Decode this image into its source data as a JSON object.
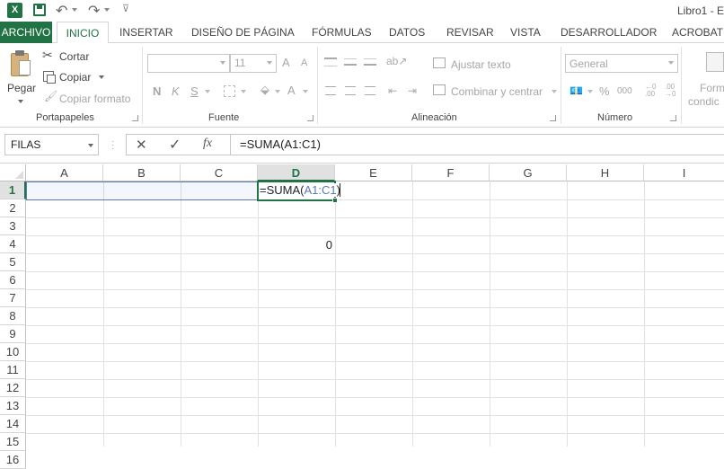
{
  "titlebar": {
    "title": "Libro1 - E"
  },
  "tabs": [
    "ARCHIVO",
    "INICIO",
    "INSERTAR",
    "DISEÑO DE PÁGINA",
    "FÓRMULAS",
    "DATOS",
    "REVISAR",
    "VISTA",
    "DESARROLLADOR",
    "ACROBAT"
  ],
  "ribbon": {
    "clipboard": {
      "paste": "Pegar",
      "cut": "Cortar",
      "copy": "Copiar",
      "format_painter": "Copiar formato",
      "label": "Portapapeles"
    },
    "font": {
      "font_name": "",
      "font_size": "11",
      "grow": "A",
      "shrink": "A",
      "bold": "N",
      "italic": "K",
      "underline": "S",
      "font_color": "A",
      "label": "Fuente"
    },
    "alignment": {
      "wrap": "Ajustar texto",
      "merge": "Combinar y centrar",
      "label": "Alineación"
    },
    "number": {
      "format": "General",
      "percent": "%",
      "thousands": "000",
      "label": "Número"
    },
    "styles": {
      "cond_format_line1": "Form",
      "cond_format_line2": "condic"
    }
  },
  "formula_bar": {
    "name_box": "FILAS",
    "cancel": "✕",
    "enter": "✓",
    "fx": "fx",
    "formula": "=SUMA(A1:C1)"
  },
  "sheet": {
    "columns": [
      "A",
      "B",
      "C",
      "D",
      "E",
      "F",
      "G",
      "H",
      "I"
    ],
    "rows": [
      "1",
      "2",
      "3",
      "4",
      "5",
      "6",
      "7",
      "8",
      "9",
      "10",
      "11",
      "12",
      "13",
      "14",
      "15",
      "16"
    ],
    "cells": {
      "D1_prefix": "=SUMA(",
      "D1_ref": "A1:C1",
      "D1_suffix": ")",
      "D4": "0"
    }
  },
  "colors": {
    "archivo_bg": "#217346",
    "accent": "#217346",
    "ref_color": "#5b7bb2",
    "selection_tint": "#f3f6fb"
  }
}
